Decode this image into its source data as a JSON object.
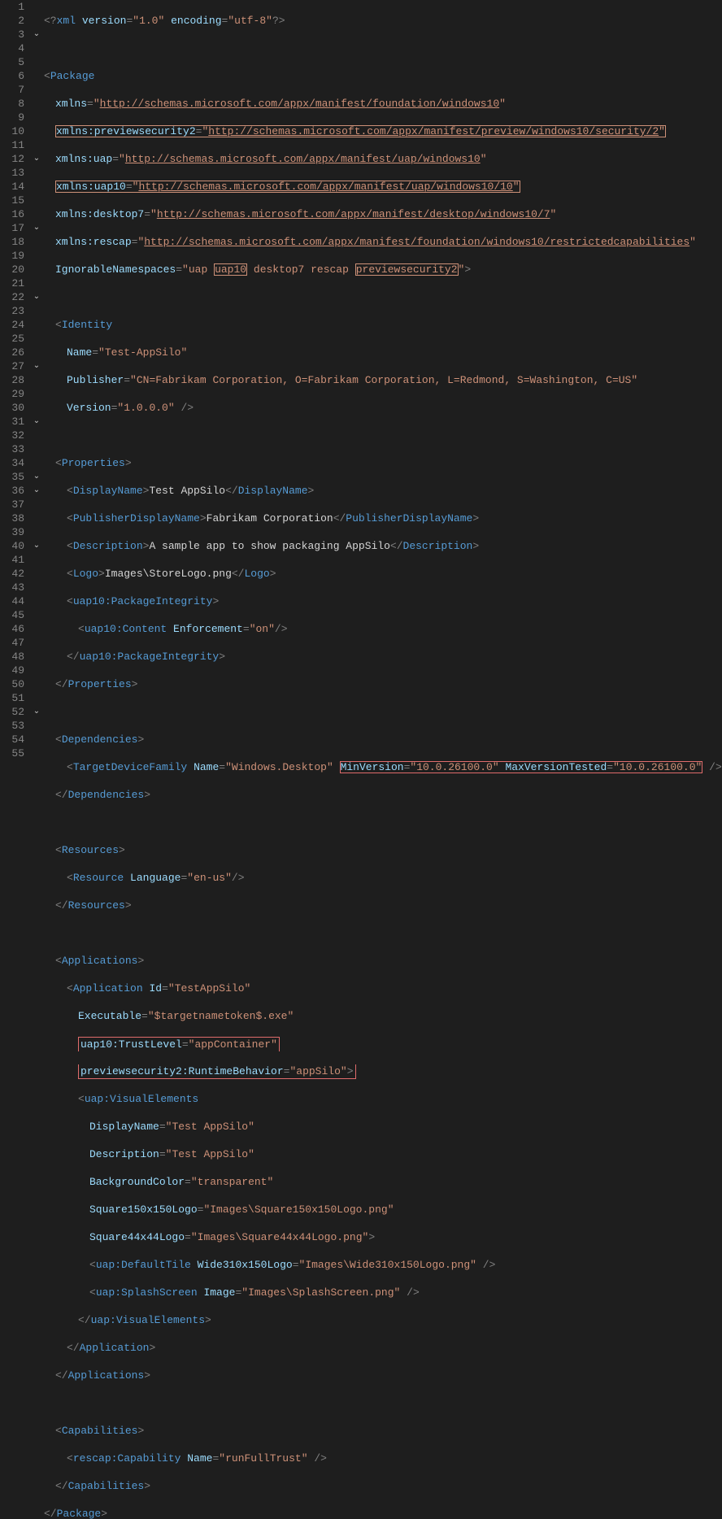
{
  "lineCount": 55,
  "foldLines": [
    3,
    12,
    17,
    22,
    27,
    31,
    35,
    36,
    40,
    52
  ],
  "xml": {
    "prolog": {
      "version": "1.0",
      "encoding": "utf-8"
    },
    "package": {
      "tag": "Package",
      "xmlns": "http://schemas.microsoft.com/appx/manifest/foundation/windows10",
      "xmlns_previewsecurity2": "http://schemas.microsoft.com/appx/manifest/preview/windows10/security/2",
      "xmlns_uap": "http://schemas.microsoft.com/appx/manifest/uap/windows10",
      "xmlns_uap10": "http://schemas.microsoft.com/appx/manifest/uap/windows10/10",
      "xmlns_desktop7": "http://schemas.microsoft.com/appx/manifest/desktop/windows10/7",
      "xmlns_rescap": "http://schemas.microsoft.com/appx/manifest/foundation/windows10/restrictedcapabilities",
      "ignorableNamespaces_pre": "uap ",
      "ignorableNamespaces_hl1": "uap10",
      "ignorableNamespaces_mid": " desktop7 rescap ",
      "ignorableNamespaces_hl2": "previewsecurity2"
    },
    "identity": {
      "tag": "Identity",
      "Name": "Test-AppSilo",
      "Publisher": "CN=Fabrikam Corporation, O=Fabrikam Corporation, L=Redmond, S=Washington, C=US",
      "Version": "1.0.0.0"
    },
    "properties": {
      "tag": "Properties",
      "DisplayName": "Test AppSilo",
      "PublisherDisplayName": "Fabrikam Corporation",
      "Description": "A sample app to show packaging AppSilo",
      "Logo": "Images\\StoreLogo.png",
      "packageIntegrityTag": "uap10:PackageIntegrity",
      "contentTag": "uap10:Content",
      "Enforcement": "on"
    },
    "dependencies": {
      "tag": "Dependencies",
      "targetTag": "TargetDeviceFamily",
      "Name": "Windows.Desktop",
      "MinVersion": "10.0.26100.0",
      "MaxVersionTested": "10.0.26100.0"
    },
    "resources": {
      "tag": "Resources",
      "resourceTag": "Resource",
      "Language": "en-us"
    },
    "applications": {
      "tag": "Applications",
      "appTag": "Application",
      "Id": "TestAppSilo",
      "Executable": "$targetnametoken$.exe",
      "TrustLevel_attr": "uap10:TrustLevel",
      "TrustLevel": "appContainer",
      "RuntimeBehavior_attr": "previewsecurity2:RuntimeBehavior",
      "RuntimeBehavior": "appSilo",
      "visualTag": "uap:VisualElements",
      "ve_DisplayName": "Test AppSilo",
      "ve_Description": "Test AppSilo",
      "ve_BackgroundColor": "transparent",
      "ve_Square150x150Logo": "Images\\Square150x150Logo.png",
      "ve_Square44x44Logo": "Images\\Square44x44Logo.png",
      "defaultTileTag": "uap:DefaultTile",
      "Wide310x150Logo": "Images\\Wide310x150Logo.png",
      "splashTag": "uap:SplashScreen",
      "splashImage": "Images\\SplashScreen.png"
    },
    "capabilities": {
      "tag": "Capabilities",
      "capTag": "rescap:Capability",
      "Name": "runFullTrust"
    }
  }
}
